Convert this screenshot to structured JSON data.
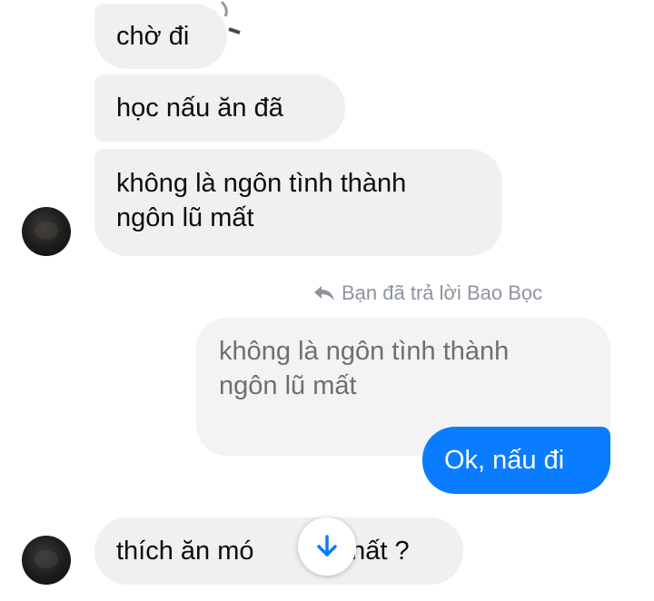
{
  "messages": [
    {
      "id": "m1",
      "side": "incoming",
      "text": "chờ đi"
    },
    {
      "id": "m2",
      "side": "incoming",
      "text": "học nấu ăn đã"
    },
    {
      "id": "m3",
      "side": "incoming",
      "lines": [
        "không là ngôn tình thành",
        "ngôn lũ mất"
      ]
    },
    {
      "id": "m4",
      "side": "outgoing",
      "quoted": true,
      "lines": [
        "không là ngôn tình thành",
        "ngôn lũ mất"
      ]
    },
    {
      "id": "m5",
      "side": "outgoing",
      "text": "Ok, nấu đi"
    },
    {
      "id": "m6",
      "side": "incoming",
      "text_left": "thích ăn mó",
      "text_right": "nhất ?"
    }
  ],
  "reply_note": {
    "text": "Bạn đã trả lời Bao Bọc",
    "icon": "reply-arrow-icon"
  },
  "scroll_button": {
    "icon": "arrow-down-icon",
    "color": "#0a7cff"
  },
  "colors": {
    "accent": "#0a7cff",
    "incoming_bubble": "#f0f0f0",
    "quoted_bubble": "#f3f3f3",
    "meta_text": "#8d949e"
  }
}
